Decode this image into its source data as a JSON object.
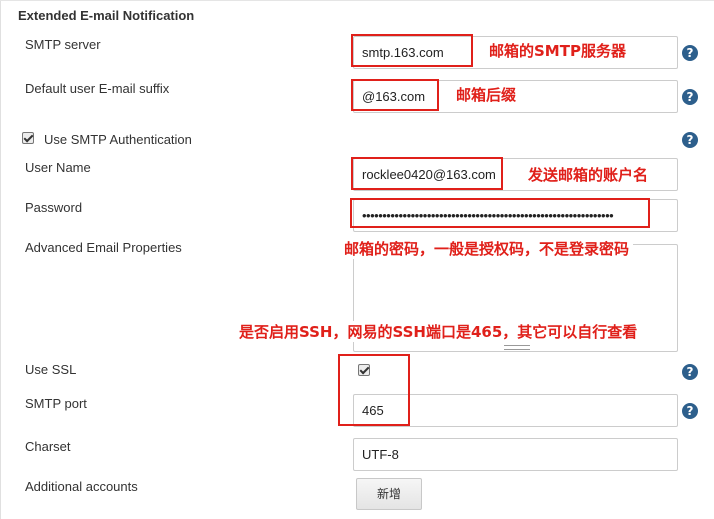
{
  "section": {
    "title": "Extended E-mail Notification"
  },
  "fields": {
    "smtp_server": {
      "label": "SMTP server",
      "value": "smtp.163.com"
    },
    "default_suffix": {
      "label": "Default user E-mail suffix",
      "value": "@163.com"
    },
    "use_smtp_auth": {
      "label": "Use SMTP Authentication",
      "checked": true
    },
    "user_name": {
      "label": "User Name",
      "value": "rocklee0420@163.com"
    },
    "password": {
      "label": "Password",
      "value": "••••••••••••••••••••••••••••••••••••••••••••••••••••••••••••••"
    },
    "advanced_props": {
      "label": "Advanced Email Properties",
      "value": ""
    },
    "use_ssl": {
      "label": "Use SSL",
      "checked": true
    },
    "smtp_port": {
      "label": "SMTP port",
      "value": "465"
    },
    "charset": {
      "label": "Charset",
      "value": "UTF-8"
    },
    "additional_accounts": {
      "label": "Additional accounts",
      "button": "新增"
    }
  },
  "help": {
    "glyph": "?"
  },
  "annotations": {
    "smtp_server": "邮箱的SMTP服务器",
    "suffix": "邮箱后缀",
    "account": "发送邮箱的账户名",
    "password": "邮箱的密码，一般是授权码，不是登录密码",
    "ssl": "是否启用SSH，网易的SSH端口是465，其它可以自行查看"
  },
  "colors": {
    "annotation": "#e0201a",
    "help_icon": "#2d5f8c"
  }
}
